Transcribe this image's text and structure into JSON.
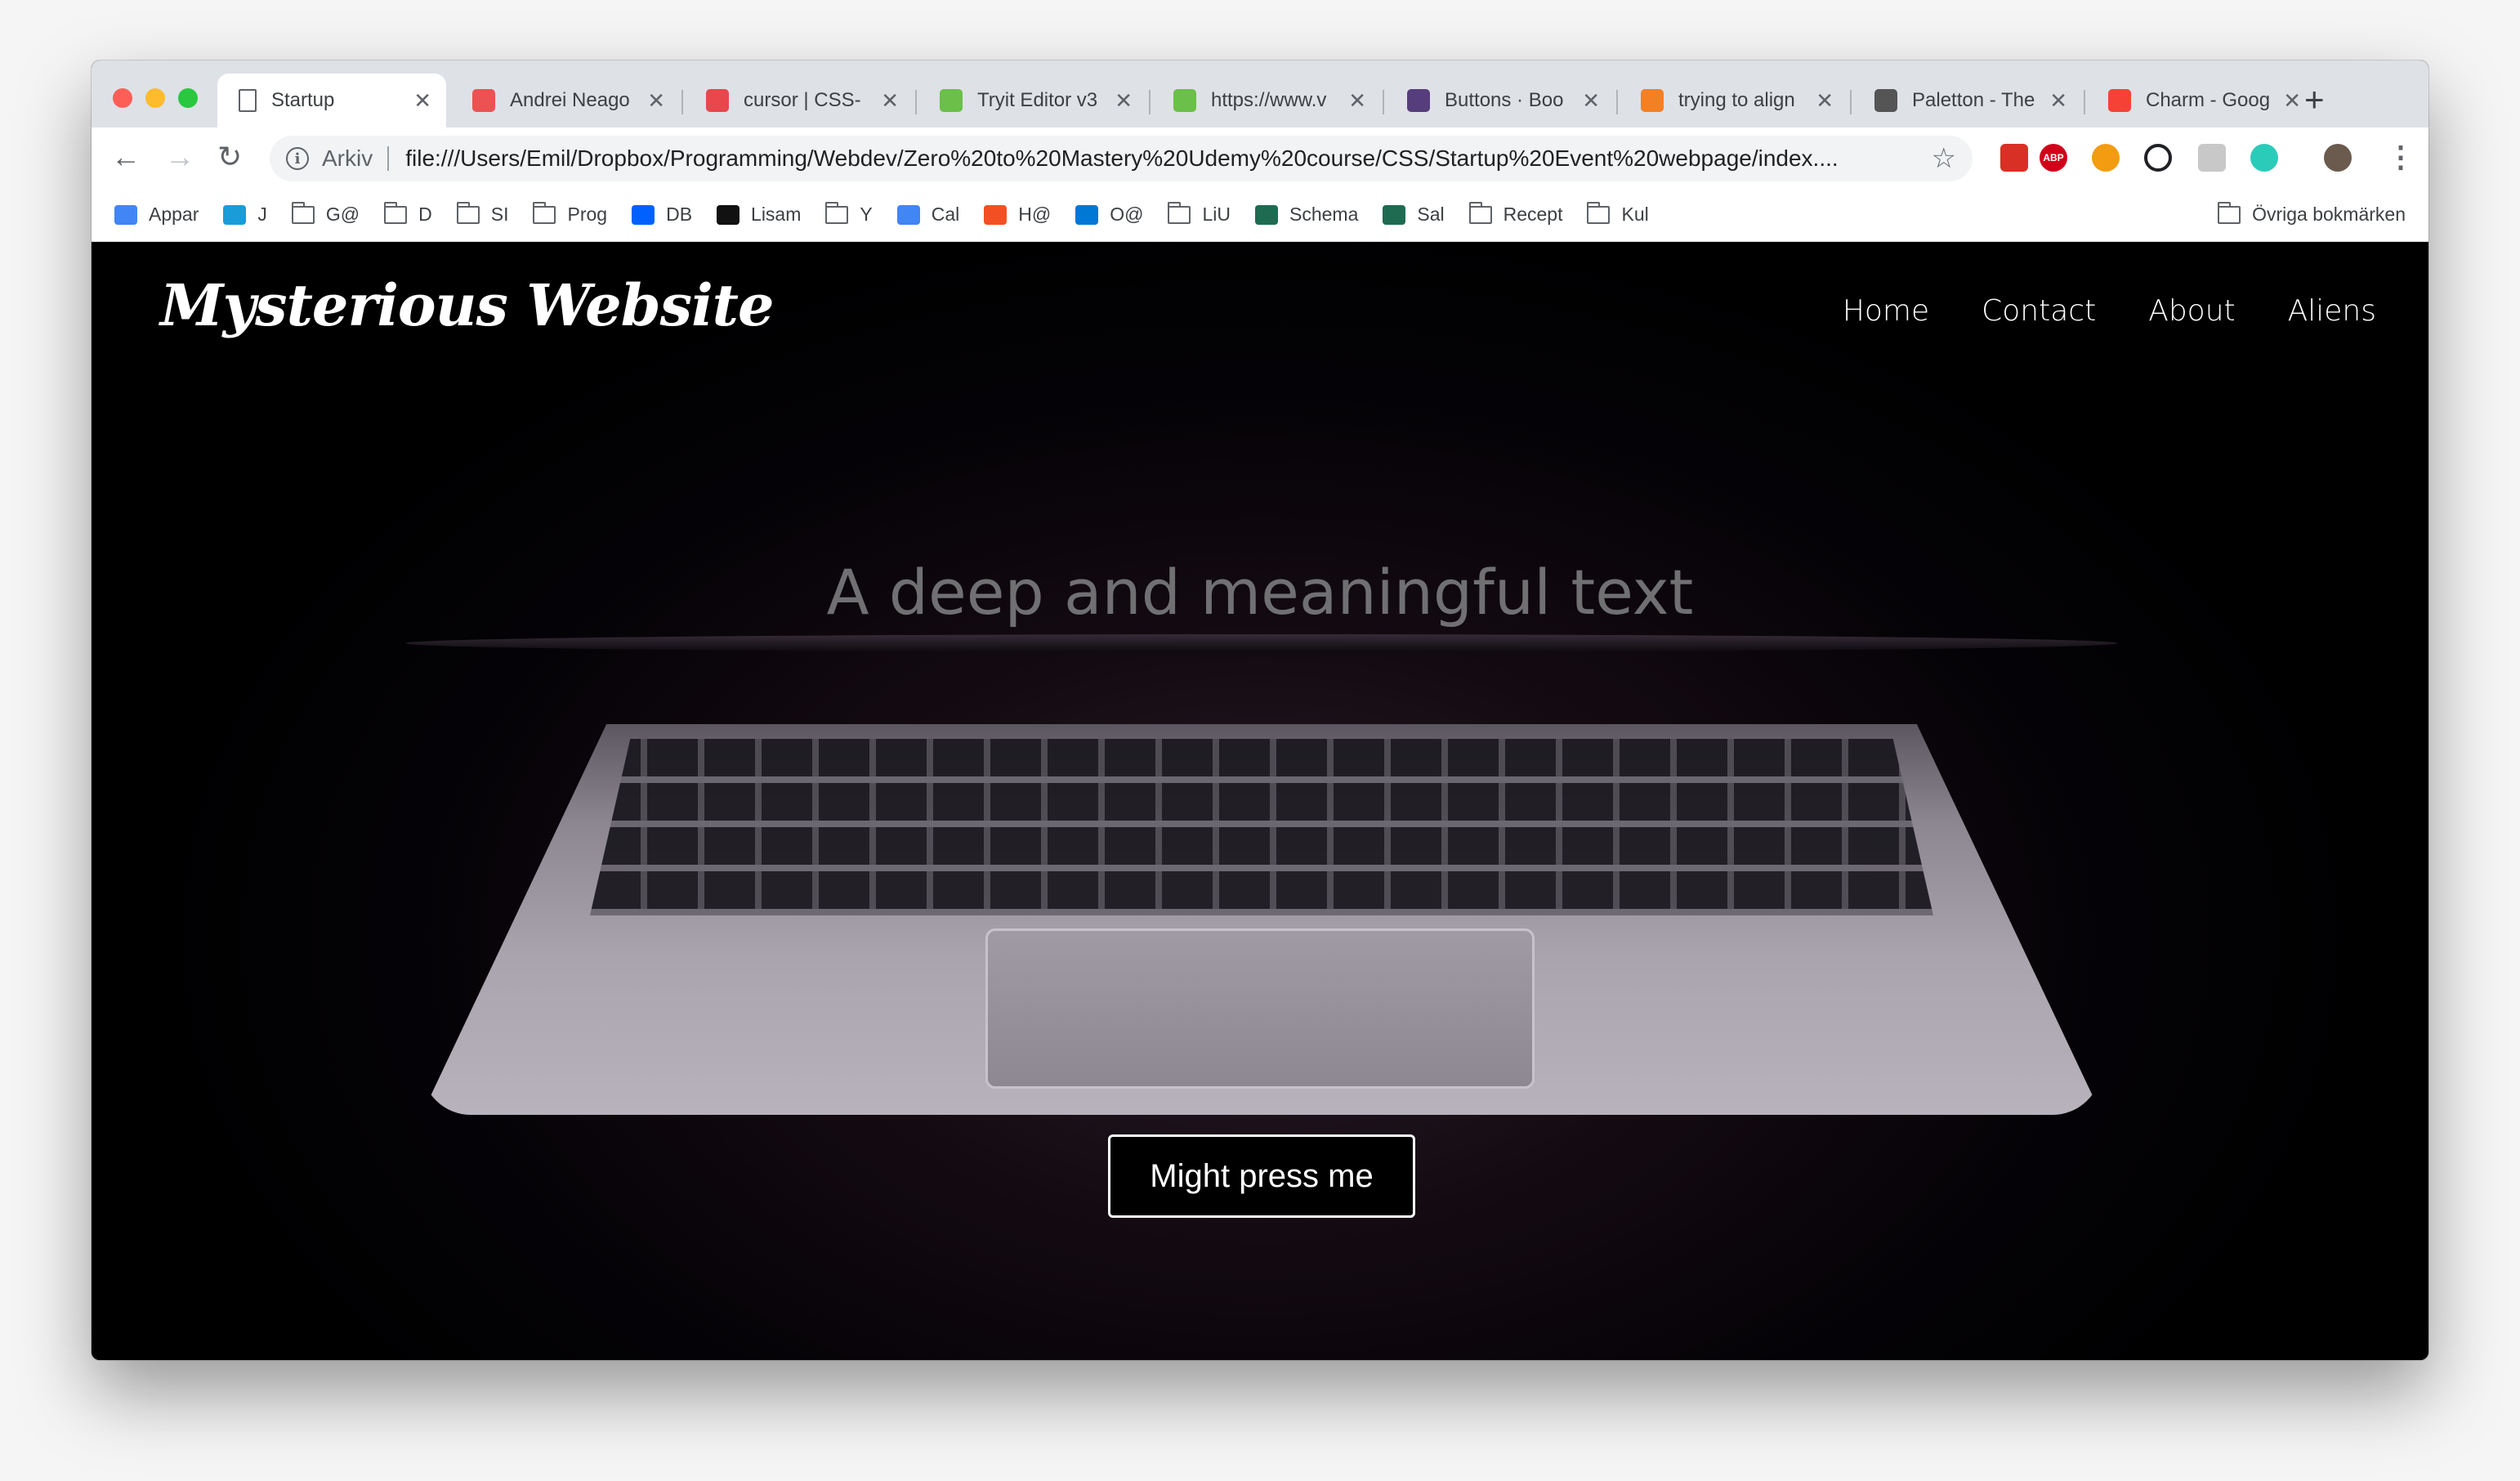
{
  "browser": {
    "tabs": [
      {
        "title": "Startup",
        "favicon": "page-icon",
        "active": true
      },
      {
        "title": "Andrei Neago",
        "favicon": "udemy-icon",
        "color": "#ec5252"
      },
      {
        "title": "cursor | CSS-",
        "favicon": "css-tricks-icon",
        "color": "#e8474c"
      },
      {
        "title": "Tryit Editor v3",
        "favicon": "w3schools-icon",
        "color": "#6ac048"
      },
      {
        "title": "https://www.v",
        "favicon": "w3schools-icon",
        "color": "#6ac048"
      },
      {
        "title": "Buttons · Boo",
        "favicon": "bootstrap-icon",
        "color": "#563d7c"
      },
      {
        "title": "trying to align",
        "favicon": "stackoverflow-icon",
        "color": "#f48024"
      },
      {
        "title": "Paletton - The",
        "favicon": "paletton-icon",
        "color": "#555555"
      },
      {
        "title": "Charm - Goog",
        "favicon": "fonts-icon",
        "color": "#f44336"
      }
    ],
    "omnibox": {
      "security_label": "Arkiv",
      "url": "file:///Users/Emil/Dropbox/Programming/Webdev/Zero%20to%20Mastery%20Udemy%20course/CSS/Startup%20Event%20webpage/index...."
    },
    "bookmarks": [
      {
        "label": "Appar",
        "icon": "apps-icon"
      },
      {
        "label": "J",
        "icon": "cloud-icon"
      },
      {
        "label": "G@",
        "icon": "folder-icon"
      },
      {
        "label": "D",
        "icon": "folder-icon"
      },
      {
        "label": "SI",
        "icon": "folder-icon"
      },
      {
        "label": "Prog",
        "icon": "folder-icon"
      },
      {
        "label": "DB",
        "icon": "dropbox-icon"
      },
      {
        "label": "Lisam",
        "icon": "liu-icon"
      },
      {
        "label": "Y",
        "icon": "folder-icon"
      },
      {
        "label": "Cal",
        "icon": "calendar-icon"
      },
      {
        "label": "H@",
        "icon": "microsoft-icon"
      },
      {
        "label": "O@",
        "icon": "outlook-icon"
      },
      {
        "label": "LiU",
        "icon": "folder-icon"
      },
      {
        "label": "Schema",
        "icon": "te-icon"
      },
      {
        "label": "Sal",
        "icon": "te-icon"
      },
      {
        "label": "Recept",
        "icon": "folder-icon"
      },
      {
        "label": "Kul",
        "icon": "folder-icon"
      }
    ],
    "other_bookmarks": "Övriga bokmärken"
  },
  "site": {
    "logo": "Mysterious Website",
    "nav": [
      "Home",
      "Contact",
      "About",
      "Aliens"
    ],
    "headline": "A deep and meaningful text",
    "cta": "Might press me"
  },
  "colors": {
    "tabstrip": "#dee1e6",
    "page_bg": "#000000",
    "headline": "#707073"
  }
}
